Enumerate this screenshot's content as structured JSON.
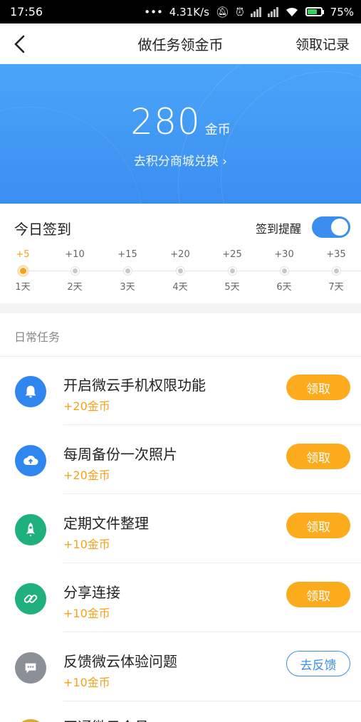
{
  "status_bar": {
    "time": "17:56",
    "net_speed": "4.31K/s",
    "battery": "75%",
    "battery_level": 0.75
  },
  "nav": {
    "title": "做任务领金币",
    "right_link": "领取记录"
  },
  "hero": {
    "coins": "280",
    "coin_unit": "金币",
    "exchange_text": "去积分商城兑换 ›"
  },
  "signin": {
    "title": "今日签到",
    "reminder_label": "签到提醒",
    "reminder_on": true,
    "days": [
      {
        "points": "+5",
        "label": "1天",
        "active": true
      },
      {
        "points": "+10",
        "label": "2天",
        "active": false
      },
      {
        "points": "+15",
        "label": "3天",
        "active": false
      },
      {
        "points": "+20",
        "label": "4天",
        "active": false
      },
      {
        "points": "+25",
        "label": "5天",
        "active": false
      },
      {
        "points": "+30",
        "label": "6天",
        "active": false
      },
      {
        "points": "+35",
        "label": "7天",
        "active": false
      }
    ]
  },
  "daily": {
    "heading": "日常任务",
    "tasks": [
      {
        "name": "开启微云手机权限功能",
        "reward": "+20金币",
        "button": "领取",
        "icon": "bell-icon",
        "color": "#2f86ef"
      },
      {
        "name": "每周备份一次照片",
        "reward": "+20金币",
        "button": "领取",
        "icon": "cloud-upload-icon",
        "color": "#2f86ef"
      },
      {
        "name": "定期文件整理",
        "reward": "+10金币",
        "button": "领取",
        "icon": "rocket-icon",
        "color": "#1fb07b"
      },
      {
        "name": "分享连接",
        "reward": "+10金币",
        "button": "领取",
        "icon": "link-icon",
        "color": "#1fb07b"
      },
      {
        "name": "反馈微云体验问题",
        "reward": "+10金币",
        "button": "去反馈",
        "icon": "chat-icon",
        "color": "#8a8f98"
      }
    ],
    "partial_task_name": "开通微云会员"
  }
}
